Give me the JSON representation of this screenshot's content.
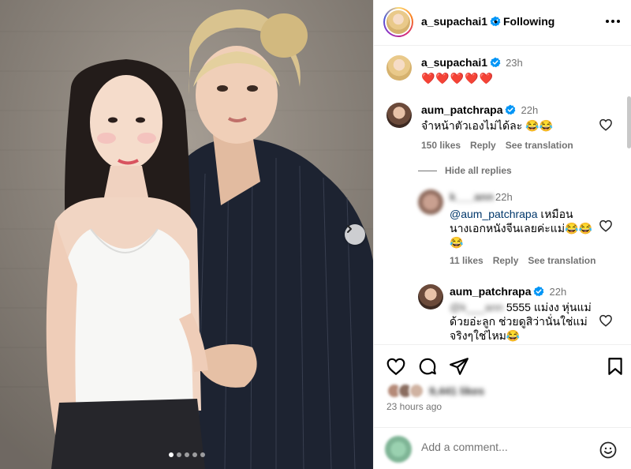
{
  "photo": {
    "description_alt": "Two women posing for a photo",
    "carousel_dots": [
      true,
      false,
      false,
      false,
      false
    ]
  },
  "header": {
    "username": "a_supachai1",
    "separator": "•",
    "follow_state": "Following"
  },
  "caption": {
    "username": "a_supachai1",
    "time": "23h",
    "text": "❤️❤️❤️❤️❤️"
  },
  "comments": [
    {
      "username": "aum_patchrapa",
      "time": "22h",
      "text": "จำหน้าตัวเองไม่ได้ละ 😂😂",
      "likes": "150 likes",
      "reply": "Reply",
      "translate": "See translation",
      "hide_replies": "Hide all replies",
      "replies": [
        {
          "username": "k___ann",
          "time": "22h",
          "mention": "@aum_patchrapa",
          "text_line1": " เหมือน",
          "text_line2": "นางเอกหนังจีนเลยค่ะแม่😂😂",
          "text_line3": "😂",
          "likes": "11 likes",
          "reply": "Reply",
          "translate": "See translation"
        },
        {
          "username": "aum_patchrapa",
          "time": "22h",
          "mention": "@k___ann",
          "text_line1": " 5555 แม่งง หุ่นแม่",
          "text_line2": "ด้วยอ่ะลูก ช่วยดูสิว่านั่นใช่แม่",
          "text_line3": "จริงๆใช่ไหม😂"
        }
      ]
    }
  ],
  "actions": {
    "likes_text": "9,441 likes",
    "time_ago": "23 hours ago"
  },
  "add_comment": {
    "placeholder": "Add a comment..."
  },
  "icons": {
    "verified_color": "#0095f6",
    "heart_red": "#ed1c24"
  }
}
